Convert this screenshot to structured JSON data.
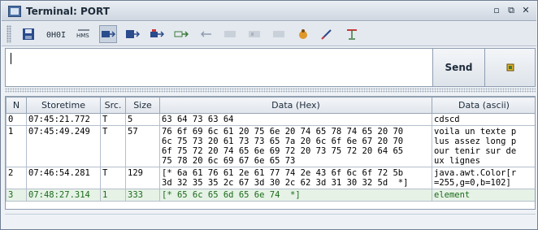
{
  "window": {
    "title": "Terminal: PORT"
  },
  "window_buttons": [
    "minimize",
    "restore",
    "close"
  ],
  "toolbar": {
    "items": [
      {
        "name": "save-icon"
      },
      {
        "name": "hex-mode-icon",
        "label": "0H0I"
      },
      {
        "name": "hms-icon",
        "label": "HMS"
      },
      {
        "name": "send-mode-1-icon"
      },
      {
        "name": "send-mode-2-icon"
      },
      {
        "name": "send-mode-3-icon"
      },
      {
        "name": "send-mode-4-icon"
      },
      {
        "name": "back-icon"
      },
      {
        "name": "disabled-1-icon"
      },
      {
        "name": "disabled-2-icon"
      },
      {
        "name": "disabled-3-icon"
      },
      {
        "name": "bug-icon"
      },
      {
        "name": "clear-icon"
      },
      {
        "name": "pin-icon"
      }
    ]
  },
  "input": {
    "value": ""
  },
  "send": {
    "label": "Send"
  },
  "table": {
    "columns": [
      "N",
      "Storetime",
      "Src.",
      "Size",
      "Data (Hex)",
      "Data (ascii)"
    ],
    "rows": [
      {
        "n": "0",
        "time": "07:45:21.772",
        "src": "T",
        "size": "5",
        "hex": [
          "63 64 73 63 64"
        ],
        "ascii": [
          "cdscd"
        ]
      },
      {
        "n": "1",
        "time": "07:45:49.249",
        "src": "T",
        "size": "57",
        "hex": [
          "76 6f 69 6c 61 20 75 6e 20 74 65 78 74 65 20 70",
          "6c 75 73 20 61 73 73 65 7a 20 6c 6f 6e 67 20 70",
          "6f 75 72 20 74 65 6e 69 72 20 73 75 72 20 64 65",
          "75 78 20 6c 69 67 6e 65 73"
        ],
        "ascii": [
          "voila un texte p",
          "lus assez long p",
          "our tenir sur de",
          "ux lignes"
        ]
      },
      {
        "n": "2",
        "time": "07:46:54.281",
        "src": "T",
        "size": "129",
        "hex": [
          "[* 6a 61 76 61 2e 61 77 74 2e 43 6f 6c 6f 72 5b",
          "3d 32 35 35 2c 67 3d 30 2c 62 3d 31 30 32 5d  *]"
        ],
        "ascii": [
          "java.awt.Color[r",
          "=255,g=0,b=102]"
        ]
      },
      {
        "n": "3",
        "time": "07:48:27.314",
        "src": "1",
        "size": "333",
        "hex": [
          "[* 65 6c 65 6d 65 6e 74  *]"
        ],
        "ascii": [
          "element"
        ],
        "color": "#1a6a1a"
      }
    ]
  }
}
